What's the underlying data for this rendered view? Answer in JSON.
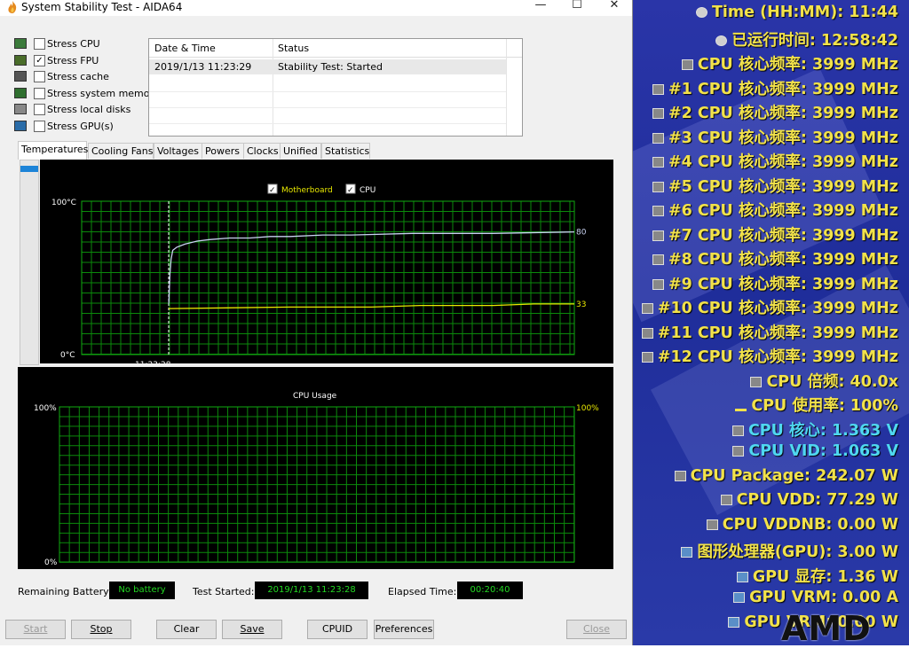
{
  "window": {
    "title": "System Stability Test - AIDA64",
    "controls": {
      "minimize": "—",
      "maximize": "☐",
      "close": "✕"
    }
  },
  "stress_options": [
    {
      "label": "Stress CPU",
      "checked": false,
      "icon": "cpu-chip-icon"
    },
    {
      "label": "Stress FPU",
      "checked": true,
      "icon": "fpu-icon"
    },
    {
      "label": "Stress cache",
      "checked": false,
      "icon": "cache-icon"
    },
    {
      "label": "Stress system memory",
      "checked": false,
      "icon": "memory-icon"
    },
    {
      "label": "Stress local disks",
      "checked": false,
      "icon": "disk-icon"
    },
    {
      "label": "Stress GPU(s)",
      "checked": false,
      "icon": "monitor-icon"
    }
  ],
  "log": {
    "headers": [
      "Date & Time",
      "Status"
    ],
    "rows": [
      [
        "2019/1/13 11:23:29",
        "Stability Test: Started"
      ]
    ]
  },
  "tabs": [
    {
      "label": "Temperatures",
      "active": true
    },
    {
      "label": "Cooling Fans",
      "active": false
    },
    {
      "label": "Voltages",
      "active": false
    },
    {
      "label": "Powers",
      "active": false
    },
    {
      "label": "Clocks",
      "active": false
    },
    {
      "label": "Unified",
      "active": false
    },
    {
      "label": "Statistics",
      "active": false
    }
  ],
  "chart_data": [
    {
      "type": "line",
      "title": "",
      "legend": [
        {
          "name": "Motherboard",
          "checked": true,
          "color": "#e8e800"
        },
        {
          "name": "CPU",
          "checked": true,
          "color": "#ffffff"
        }
      ],
      "ylim": [
        0,
        100
      ],
      "y_top_label": "100°C",
      "y_bottom_label": "0°C",
      "x_marker_label": "11:23:28",
      "series": [
        {
          "name": "CPU",
          "color": "#c8d2f0",
          "end_value": "80",
          "x": [
            0,
            0.05,
            0.3,
            0.6,
            1,
            2,
            4,
            7,
            10,
            15,
            20,
            25,
            30,
            38,
            45,
            60,
            80,
            100
          ],
          "values": [
            33,
            34,
            52,
            62,
            68,
            70,
            72,
            74,
            75,
            76,
            76,
            77,
            77,
            78,
            78,
            79,
            79,
            80
          ]
        },
        {
          "name": "Motherboard",
          "color": "#e8e800",
          "end_value": "33",
          "x": [
            0,
            30,
            50,
            62,
            70,
            80,
            90,
            100
          ],
          "values": [
            30,
            31,
            31,
            32,
            32,
            32,
            33,
            33
          ]
        }
      ]
    },
    {
      "type": "line",
      "title": "CPU Usage",
      "ylim": [
        0,
        100
      ],
      "y_top_label": "100%",
      "y_bottom_label": "0%",
      "series": [
        {
          "name": "",
          "color": "#e8e800",
          "end_value": "100%",
          "values": [
            100,
            100
          ]
        }
      ]
    }
  ],
  "status_bar": {
    "battery_label": "Remaining Battery:",
    "battery_value": "No battery",
    "started_label": "Test Started:",
    "started_value": "2019/1/13 11:23:28",
    "elapsed_label": "Elapsed Time:",
    "elapsed_value": "00:20:40"
  },
  "buttons": {
    "start": "Start",
    "stop": "Stop",
    "clear": "Clear",
    "save": "Save",
    "cpuid": "CPUID",
    "preferences": "Preferences",
    "close": "Close"
  },
  "osd": {
    "colors": {
      "yellow": "#f2e24a",
      "cyan": "#4fd8f0"
    },
    "lines": [
      {
        "text": "Time (HH:MM): 11:44",
        "color": "yellow",
        "icon": "clock-icon"
      },
      {
        "text": "已运行时间: 12:58:42",
        "color": "yellow",
        "icon": "clock-icon"
      },
      {
        "text": "CPU 核心频率: 3999 MHz",
        "color": "yellow",
        "icon": "cpu-icon"
      },
      {
        "text": "#1 CPU 核心频率: 3999 MHz",
        "color": "yellow",
        "icon": "cpu-icon"
      },
      {
        "text": "#2 CPU 核心频率: 3999 MHz",
        "color": "yellow",
        "icon": "cpu-icon"
      },
      {
        "text": "#3 CPU 核心频率: 3999 MHz",
        "color": "yellow",
        "icon": "cpu-icon"
      },
      {
        "text": "#4 CPU 核心频率: 3999 MHz",
        "color": "yellow",
        "icon": "cpu-icon"
      },
      {
        "text": "#5 CPU 核心频率: 3999 MHz",
        "color": "yellow",
        "icon": "cpu-icon"
      },
      {
        "text": "#6 CPU 核心频率: 3999 MHz",
        "color": "yellow",
        "icon": "cpu-icon"
      },
      {
        "text": "#7 CPU 核心频率: 3999 MHz",
        "color": "yellow",
        "icon": "cpu-icon"
      },
      {
        "text": "#8 CPU 核心频率: 3999 MHz",
        "color": "yellow",
        "icon": "cpu-icon"
      },
      {
        "text": "#9 CPU 核心频率: 3999 MHz",
        "color": "yellow",
        "icon": "cpu-icon"
      },
      {
        "text": "#10 CPU 核心频率: 3999 MHz",
        "color": "yellow",
        "icon": "cpu-icon"
      },
      {
        "text": "#11 CPU 核心频率: 3999 MHz",
        "color": "yellow",
        "icon": "cpu-icon"
      },
      {
        "text": "#12 CPU 核心频率: 3999 MHz",
        "color": "yellow",
        "icon": "cpu-icon"
      },
      {
        "text": "CPU 倍频: 40.0x",
        "color": "yellow",
        "icon": "cpu-icon"
      },
      {
        "text": "CPU 使用率: 100%",
        "color": "yellow",
        "icon": "usage-icon"
      },
      {
        "text": "CPU 核心: 1.363 V",
        "color": "cyan",
        "icon": "cpu-icon"
      },
      {
        "text": "CPU VID: 1.063 V",
        "color": "cyan",
        "icon": "cpu-icon"
      },
      {
        "text": "CPU Package: 242.07 W",
        "color": "yellow",
        "icon": "cpu-icon"
      },
      {
        "text": "CPU VDD: 77.29 W",
        "color": "yellow",
        "icon": "cpu-icon"
      },
      {
        "text": "CPU VDDNB: 0.00 W",
        "color": "yellow",
        "icon": "cpu-icon"
      },
      {
        "text": "图形处理器(GPU): 3.00 W",
        "color": "yellow",
        "icon": "gpu-icon"
      },
      {
        "text": "GPU 显存: 1.36 W",
        "color": "yellow",
        "icon": "gpu-icon"
      },
      {
        "text": "GPU VRM: 0.00 A",
        "color": "yellow",
        "icon": "gpu-icon"
      },
      {
        "text": "GPU VRM: 0.00 W",
        "color": "yellow",
        "icon": "gpu-icon"
      }
    ],
    "watermark": "AMD"
  }
}
